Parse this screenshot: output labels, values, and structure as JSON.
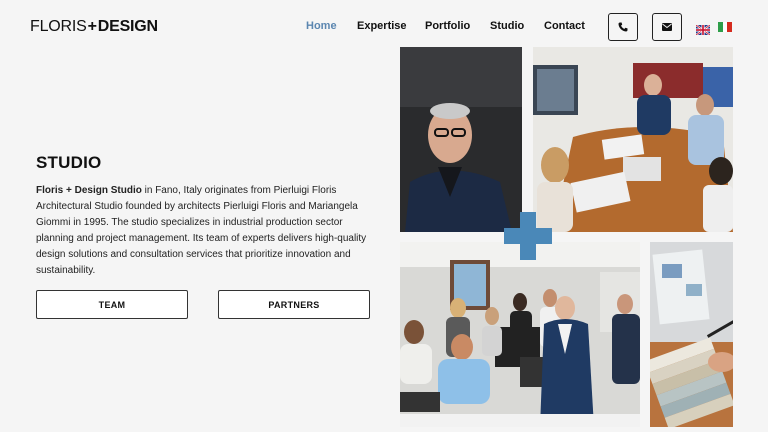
{
  "brand": {
    "light": "FLORIS",
    "plus": "+",
    "bold": "DESIGN"
  },
  "nav": {
    "items": [
      "Home",
      "Expertise",
      "Portfolio",
      "Studio",
      "Contact"
    ],
    "active": "Home"
  },
  "contact_icons": [
    "phone-icon",
    "mail-icon"
  ],
  "languages": [
    "uk-flag",
    "italy-flag"
  ],
  "studio": {
    "heading": "STUDIO",
    "lead": "Floris + Design Studio",
    "body": " in Fano, Italy originates from Pierluigi Floris Architectural Studio founded by architects Pierluigi Floris and Mariangela Giommi in 1995. The studio specializes in industrial production sector planning and project management. Its team of experts delivers high-quality design solutions and consultation services that prioritize innovation and sustainability."
  },
  "buttons": {
    "team": "TEAM",
    "partners": "PARTNERS"
  },
  "colors": {
    "accent": "#5b86b0",
    "cross": "#4a88b8",
    "background": "#f5f5f5"
  }
}
